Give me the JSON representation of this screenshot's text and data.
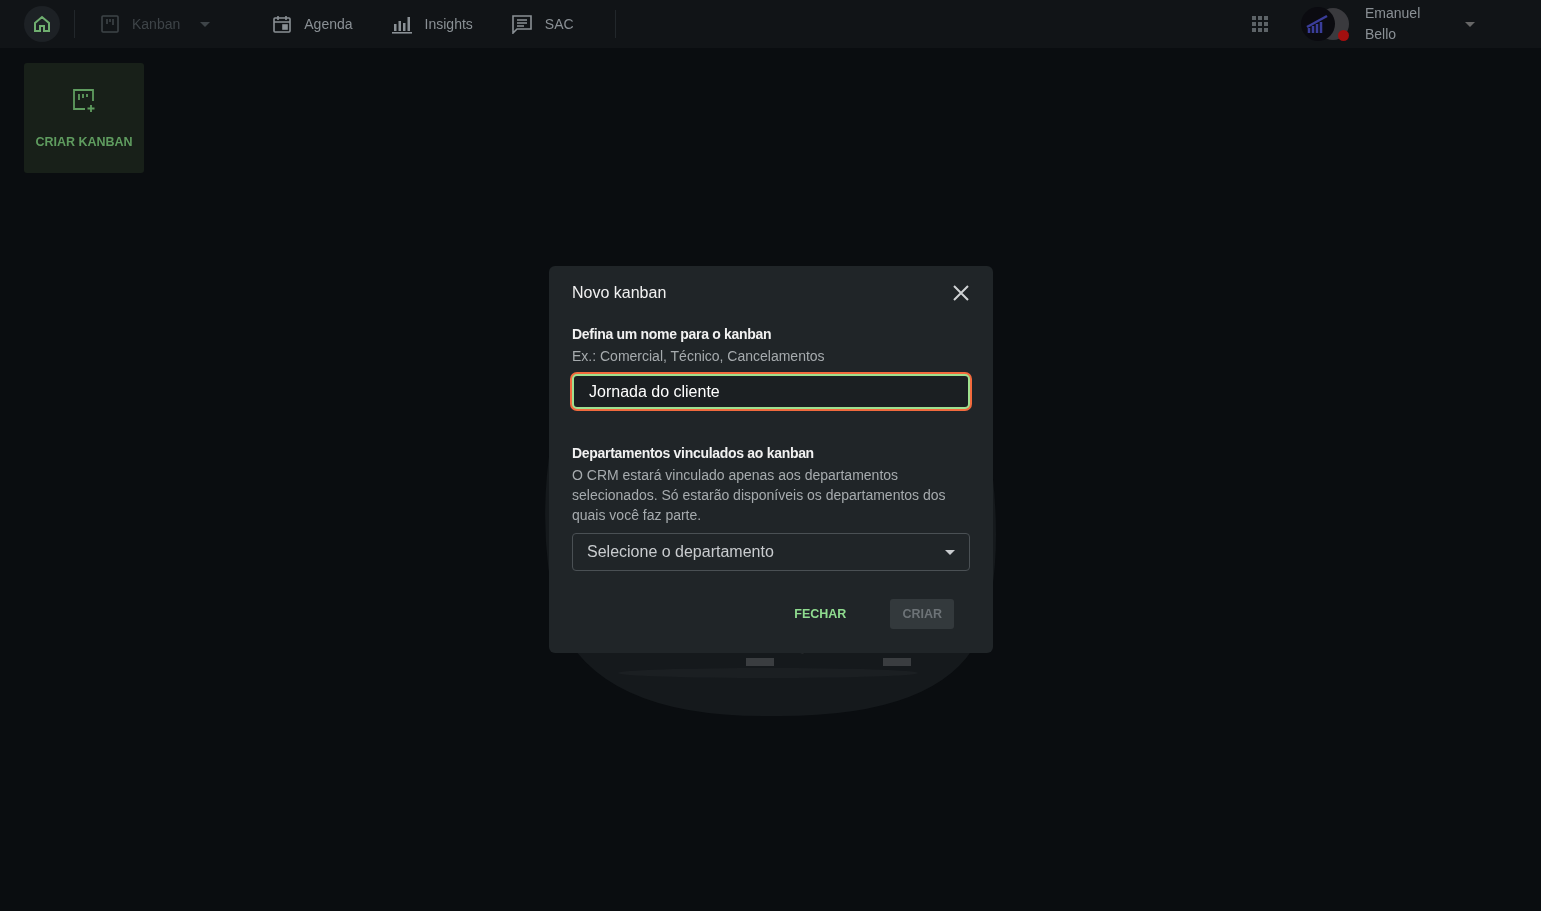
{
  "topbar": {
    "home": {
      "selected": true
    },
    "nav": [
      {
        "label": "Kanban",
        "disabled": true,
        "dropdown": true
      },
      {
        "label": "Agenda",
        "disabled": false,
        "dropdown": false
      },
      {
        "label": "Insights",
        "disabled": false,
        "dropdown": false
      },
      {
        "label": "SAC",
        "disabled": false,
        "dropdown": false
      }
    ],
    "user": {
      "name": "Emanuel Bello"
    }
  },
  "create_card": {
    "label": "CRIAR KANBAN"
  },
  "dialog": {
    "title": "Novo kanban",
    "name_section": {
      "label": "Defina um nome para o kanban",
      "hint": "Ex.: Comercial, Técnico, Cancelamentos",
      "value": "Jornada do cliente",
      "focused": true
    },
    "department_section": {
      "label": "Departamentos vinculados ao kanban",
      "description": "O CRM estará vinculado apenas aos departamentos selecionados. Só estarão disponíveis os departamentos dos quais você faz parte.",
      "placeholder": "Selecione o departamento"
    },
    "buttons": [
      {
        "label": "FECHAR",
        "kind": "text",
        "disabled": false
      },
      {
        "label": "CRIAR",
        "kind": "filled",
        "disabled": true
      }
    ]
  }
}
